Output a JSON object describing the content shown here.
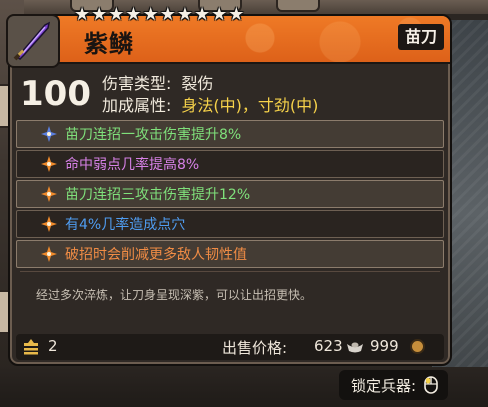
{
  "item": {
    "name": "紫鳞",
    "type_badge": "苗刀",
    "star_count": 10,
    "damage": "100",
    "damage_type_label": "伤害类型:",
    "damage_type_value": "裂伤",
    "bonus_attr_label": "加成属性:",
    "bonus_attr_value_1": "身法(中)",
    "bonus_attr_sep": "，",
    "bonus_attr_value_2": "寸劲(中)",
    "affixes": [
      {
        "text": "苗刀连招一攻击伤害提升8%",
        "color": "#7fe07b",
        "bullet": "blue"
      },
      {
        "text": "命中弱点几率提高8%",
        "color": "#d681e6",
        "bullet": "orange"
      },
      {
        "text": "苗刀连招三攻击伤害提升12%",
        "color": "#7fe07b",
        "bullet": "orange"
      },
      {
        "text": "有4%几率造成点穴",
        "color": "#4f9cf0",
        "bullet": "orange"
      },
      {
        "text": "破招时会削减更多敌人韧性值",
        "color": "#f08c45",
        "bullet": "orange"
      }
    ],
    "description": "经过多次淬炼，让刀身呈现深紫，可以让出招更快。",
    "level": "2",
    "price_label": "出售价格:",
    "price_silver": "623",
    "price_other": "999"
  },
  "prompt": {
    "lock_label": "锁定兵器:"
  },
  "colors": {
    "header_orange": "#e86a1f",
    "panel_bg": "#2f2925",
    "stat_yellow": "#f6d24a"
  },
  "icons": {
    "weapon": "purple-blade-icon",
    "level": "level-tier-icon",
    "silver": "silver-ingot-icon",
    "coin": "coin-icon",
    "mouse": "mouse-icon"
  }
}
